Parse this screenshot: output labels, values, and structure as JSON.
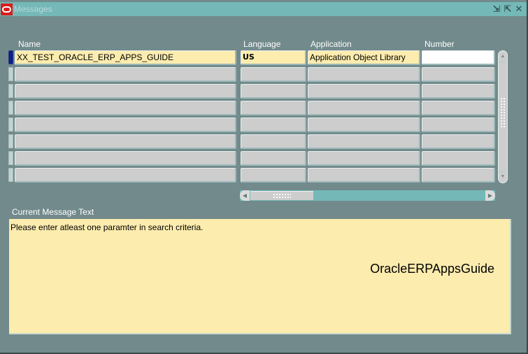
{
  "window": {
    "title": "Messages",
    "logo_icon": "oracle-logo-icon",
    "controls": [
      {
        "name": "minimize",
        "icon": "minimize-icon",
        "glyph": "⇲"
      },
      {
        "name": "maximize",
        "icon": "maximize-icon",
        "glyph": "⇱"
      },
      {
        "name": "close",
        "icon": "close-icon",
        "glyph": "✕"
      }
    ]
  },
  "table": {
    "columns": [
      {
        "key": "name",
        "label": "Name"
      },
      {
        "key": "language",
        "label": "Language"
      },
      {
        "key": "application",
        "label": "Application"
      },
      {
        "key": "number",
        "label": "Number"
      }
    ],
    "rows": [
      {
        "name": "XX_TEST_ORACLE_ERP_APPS_GUIDE",
        "language": "US",
        "application": "Application Object Library",
        "number": "",
        "current": true
      },
      {
        "name": "",
        "language": "",
        "application": "",
        "number": ""
      },
      {
        "name": "",
        "language": "",
        "application": "",
        "number": ""
      },
      {
        "name": "",
        "language": "",
        "application": "",
        "number": ""
      },
      {
        "name": "",
        "language": "",
        "application": "",
        "number": ""
      },
      {
        "name": "",
        "language": "",
        "application": "",
        "number": ""
      },
      {
        "name": "",
        "language": "",
        "application": "",
        "number": ""
      },
      {
        "name": "",
        "language": "",
        "application": "",
        "number": ""
      }
    ]
  },
  "message": {
    "label": "Current Message Text",
    "text": "Please enter atleast one paramter in search criteria.",
    "watermark": "OracleERPAppsGuide"
  },
  "scrollbars": {
    "vertical": {
      "up_glyph": "▲",
      "down_glyph": "▼"
    },
    "horizontal": {
      "left_glyph": "◀",
      "right_glyph": "▶"
    }
  },
  "colors": {
    "background": "#728a8b",
    "titlebar": "#74b8b8",
    "current_field": "#fcecae",
    "empty_field": "#cdcdcd",
    "record_indicator": "#0c1f8a"
  }
}
